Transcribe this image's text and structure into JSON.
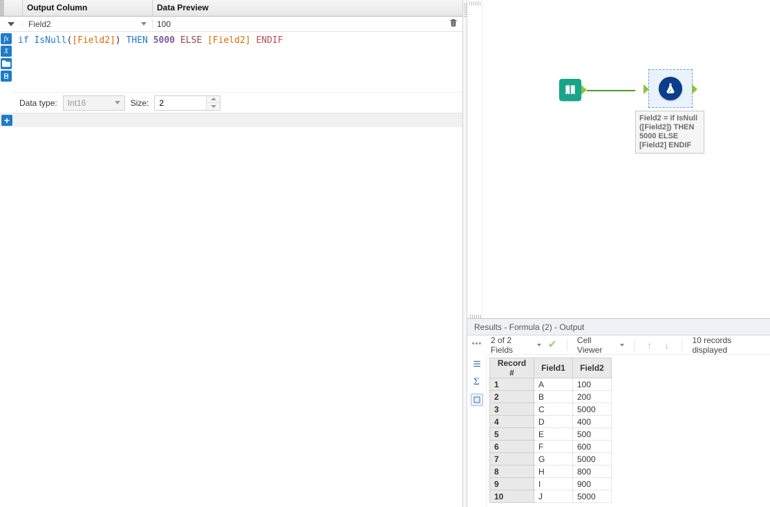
{
  "config": {
    "headers": {
      "output_column": "Output Column",
      "data_preview": "Data Preview"
    },
    "row": {
      "field_name": "Field2",
      "preview": "100"
    },
    "expression_tokens": {
      "if": "if",
      "fn": "IsNull",
      "field": "[Field2]",
      "then": "THEN",
      "num": "5000",
      "else": "ELSE",
      "field2": "[Field2]",
      "endif": "ENDIF"
    },
    "type": {
      "label": "Data type:",
      "value": "Int16",
      "size_label": "Size:",
      "size_value": "2"
    }
  },
  "canvas": {
    "formula_caption_l1": "Field2 = if IsNull",
    "formula_caption_l2": "([Field2]) THEN",
    "formula_caption_l3": "5000 ELSE",
    "formula_caption_l4": "[Field2] ENDIF"
  },
  "results": {
    "title": "Results - Formula (2) - Output",
    "fields_summary": "2 of 2 Fields",
    "cell_viewer": "Cell Viewer",
    "records_displayed": "10 records displayed",
    "columns": {
      "recno": "Record #",
      "f1": "Field1",
      "f2": "Field2"
    },
    "rows": [
      {
        "n": "1",
        "f1": "A",
        "f2": "100"
      },
      {
        "n": "2",
        "f1": "B",
        "f2": "200"
      },
      {
        "n": "3",
        "f1": "C",
        "f2": "5000"
      },
      {
        "n": "4",
        "f1": "D",
        "f2": "400"
      },
      {
        "n": "5",
        "f1": "E",
        "f2": "500"
      },
      {
        "n": "6",
        "f1": "F",
        "f2": "600"
      },
      {
        "n": "7",
        "f1": "G",
        "f2": "5000"
      },
      {
        "n": "8",
        "f1": "H",
        "f2": "800"
      },
      {
        "n": "9",
        "f1": "I",
        "f2": "900"
      },
      {
        "n": "10",
        "f1": "J",
        "f2": "5000"
      }
    ]
  }
}
